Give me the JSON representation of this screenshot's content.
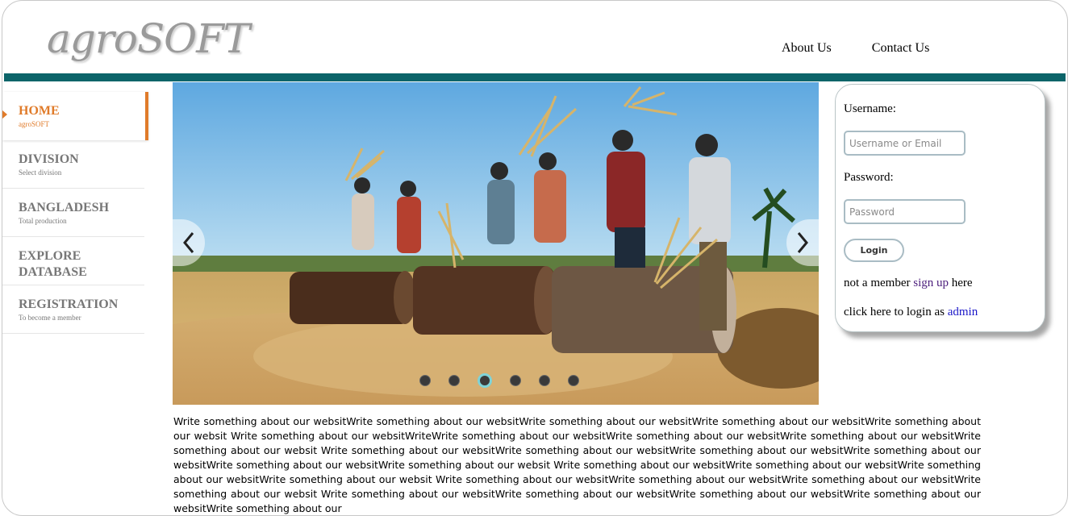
{
  "header": {
    "logo": "agroSOFT",
    "nav": [
      "About Us",
      "Contact Us"
    ]
  },
  "sidebar": {
    "items": [
      {
        "title": "HOME",
        "subtitle": "agroSOFT",
        "active": true
      },
      {
        "title": "DIVISION",
        "subtitle": "Select division",
        "active": false
      },
      {
        "title": "BANGLADESH",
        "subtitle": "Total production",
        "active": false
      },
      {
        "title": "EXPLORE DATABASE",
        "subtitle": "",
        "active": false
      },
      {
        "title": "REGISTRATION",
        "subtitle": "To become a member",
        "active": false
      }
    ]
  },
  "slider": {
    "slide_count": 6,
    "active_index": 2
  },
  "login": {
    "username_label": "Username:",
    "username_placeholder": "Username or Email",
    "password_label": "Password:",
    "password_placeholder": "Password",
    "button_label": "Login",
    "signup_prefix": "not a member ",
    "signup_link": "sign up",
    "signup_suffix": " here",
    "admin_prefix": "click here to login as ",
    "admin_link": "admin"
  },
  "content": {
    "about": "Write something about our websitWrite something about our websitWrite something about our websitWrite something about our websitWrite something about our websit Write something about our websitWriteWrite something about our websitWrite something about our websitWrite something about our websitWrite something about our websit Write something about our websitWrite something about our websitWrite something about our websitWrite something about our websitWrite something about our websitWrite something about our websit Write something about our websitWrite something about our websitWrite something about our websitWrite something about our websit Write something about our websitWrite something about our websitWrite something about our websitWrite something about our websit Write something about our websitWrite something about our websitWrite something about our websitWrite something about our websitWrite something about our"
  },
  "colors": {
    "accent": "#e07b2a",
    "header_bar": "#0c6469",
    "signup_link": "#4b1d7c",
    "admin_link": "#1a17c8"
  }
}
